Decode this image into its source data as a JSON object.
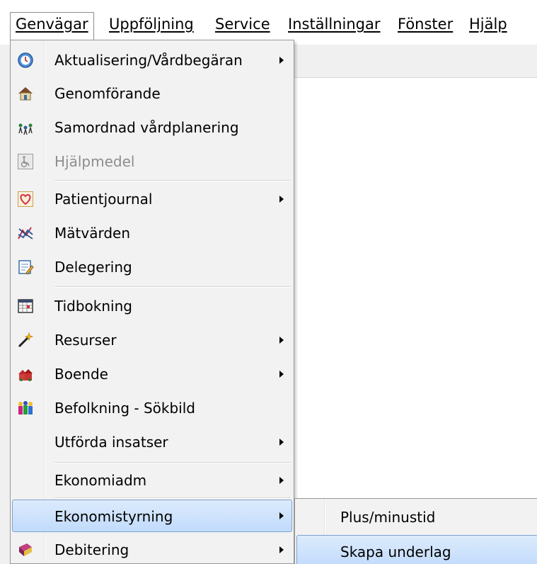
{
  "menubar": {
    "items": [
      {
        "label": "Genvägar",
        "mnemonic_index": 0
      },
      {
        "label": "Uppföljning",
        "mnemonic_index": 0
      },
      {
        "label": "Service",
        "mnemonic_index": 0
      },
      {
        "label": "Inställningar",
        "mnemonic_index": 0
      },
      {
        "label": "Fönster",
        "mnemonic_index": 0
      },
      {
        "label": "Hjälp",
        "mnemonic_index": 0
      }
    ]
  },
  "dropdown": {
    "items": [
      {
        "label": "Aktualisering/Vårdbegäran",
        "icon": "clock-gear-icon",
        "submenu": true
      },
      {
        "label": "Genomförande",
        "icon": "house-icon",
        "submenu": false
      },
      {
        "label": "Samordnad vårdplanering",
        "icon": "people-chain-icon",
        "submenu": false
      },
      {
        "label": "Hjälpmedel",
        "icon": "wheelchair-icon",
        "submenu": false,
        "disabled": true
      },
      {
        "label": "Patientjournal",
        "icon": "heart-icon",
        "submenu": true
      },
      {
        "label": "Mätvärden",
        "icon": "chart-icon",
        "submenu": false
      },
      {
        "label": "Delegering",
        "icon": "document-pencil-icon",
        "submenu": false
      },
      {
        "label": "Tidbokning",
        "icon": "calendar-icon",
        "submenu": false
      },
      {
        "label": "Resurser",
        "icon": "magic-wand-icon",
        "submenu": true
      },
      {
        "label": "Boende",
        "icon": "house-group-icon",
        "submenu": true
      },
      {
        "label": "Befolkning - Sökbild",
        "icon": "population-icon",
        "submenu": false
      },
      {
        "label": "Utförda insatser",
        "icon": "",
        "submenu": true
      },
      {
        "label": "Ekonomiadm",
        "icon": "",
        "submenu": true
      },
      {
        "label": "Ekonomistyrning",
        "icon": "",
        "submenu": true,
        "highlighted": true
      },
      {
        "label": "Debitering",
        "icon": "book-icon",
        "submenu": true
      }
    ]
  },
  "submenu": {
    "items": [
      {
        "label": "Plus/minustid"
      },
      {
        "label": "Skapa underlag",
        "highlighted": true
      }
    ]
  },
  "colors": {
    "highlight_top": "#dcebfc",
    "highlight_bottom": "#c1dbfc",
    "highlight_border": "#7da2ce",
    "menu_bg": "#f2f2f2"
  }
}
